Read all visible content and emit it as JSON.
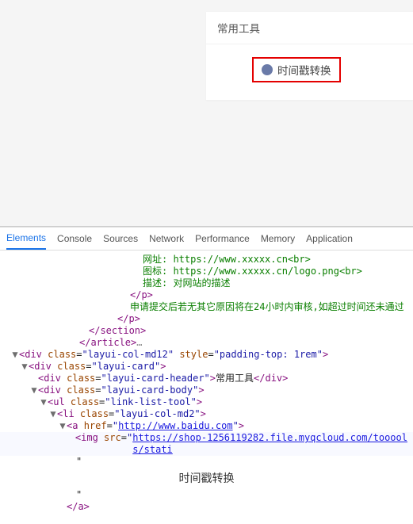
{
  "card": {
    "header": "常用工具",
    "tool_label": "时间戳转换"
  },
  "tabs": {
    "elements": "Elements",
    "console": "Console",
    "sources": "Sources",
    "network": "Network",
    "performance": "Performance",
    "memory": "Memory",
    "application": "Application"
  },
  "dom": {
    "l1": "网址: https://www.xxxxx.cn<br>",
    "l2": "图标: https://www.xxxxx.cn/logo.png<br>",
    "l3": "描述: 对网站的描述",
    "l4": "</p>",
    "l5": "申请提交后若无其它原因将在24小时内审核,如超过时间还未通过",
    "l6": "</p>",
    "l7": "</section>",
    "l8": "</article>",
    "l8e": "…",
    "open": "▼",
    "right": "▶",
    "div_open": "<div",
    "div_close": "</div>",
    "class_attr": "class",
    "style_attr": "style",
    "src_attr": "src",
    "href_attr": "href",
    "cls_md12": "\"layui-col-md12\"",
    "sty_pad": "\"padding-top: 1rem\"",
    "cls_card": "\"layui-card\"",
    "cls_card_header": "\"layui-card-header\"",
    "header_text": "常用工具",
    "cls_card_body": "\"layui-card-body\"",
    "ul_open": "<ul",
    "cls_ul": "\"link-list-tool\"",
    "li_open": "<li",
    "cls_li": "\"layui-col-md2\"",
    "a_open": "<a",
    "href_url": "http://www.baidu.com",
    "img_open": "<img",
    "img_src": "https://shop-1256119282.file.myqcloud.com/tooools/stati",
    "quote": "\"",
    "middle_text": "时间戳转换",
    "a_close": "</a>",
    "close_angle": ">"
  }
}
